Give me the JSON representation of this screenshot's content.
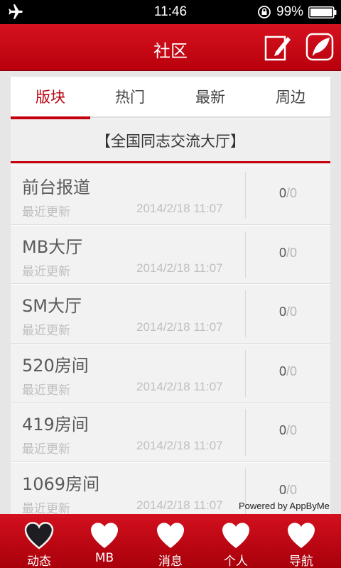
{
  "status_bar": {
    "time": "11:46",
    "battery": "99%"
  },
  "header": {
    "title": "社区",
    "compose_icon": "compose-icon",
    "feather_icon": "feather-icon"
  },
  "tabs": [
    {
      "label": "版块"
    },
    {
      "label": "热门"
    },
    {
      "label": "最新"
    },
    {
      "label": "周边"
    }
  ],
  "active_tab": "版块",
  "section_title": "【全国同志交流大厅】",
  "rows": [
    {
      "name": "前台报道",
      "label": "最近更新",
      "date": "2014/2/18 11:07",
      "count_a": "0",
      "count_b": "/0"
    },
    {
      "name": "MB大厅",
      "label": "最近更新",
      "date": "2014/2/18 11:07",
      "count_a": "0",
      "count_b": "/0"
    },
    {
      "name": "SM大厅",
      "label": "最近更新",
      "date": "2014/2/18 11:07",
      "count_a": "0",
      "count_b": "/0"
    },
    {
      "name": "520房间",
      "label": "最近更新",
      "date": "2014/2/18 11:07",
      "count_a": "0",
      "count_b": "/0"
    },
    {
      "name": "419房间",
      "label": "最近更新",
      "date": "2014/2/18 11:07",
      "count_a": "0",
      "count_b": "/0"
    },
    {
      "name": "1069房间",
      "label": "最近更新",
      "date": "2014/2/18 11:07",
      "count_a": "0",
      "count_b": "/0"
    }
  ],
  "powered_by": "Powered by AppByMe",
  "bottom_nav": [
    {
      "label": "动态",
      "icon": "heart-dark-icon"
    },
    {
      "label": "MB",
      "icon": "heart-icon"
    },
    {
      "label": "消息",
      "icon": "heart-icon"
    },
    {
      "label": "个人",
      "icon": "heart-icon"
    },
    {
      "label": "导航",
      "icon": "heart-icon"
    }
  ],
  "colors": {
    "brand_red": "#c4000f",
    "active_tab_text": "#b8000c"
  }
}
